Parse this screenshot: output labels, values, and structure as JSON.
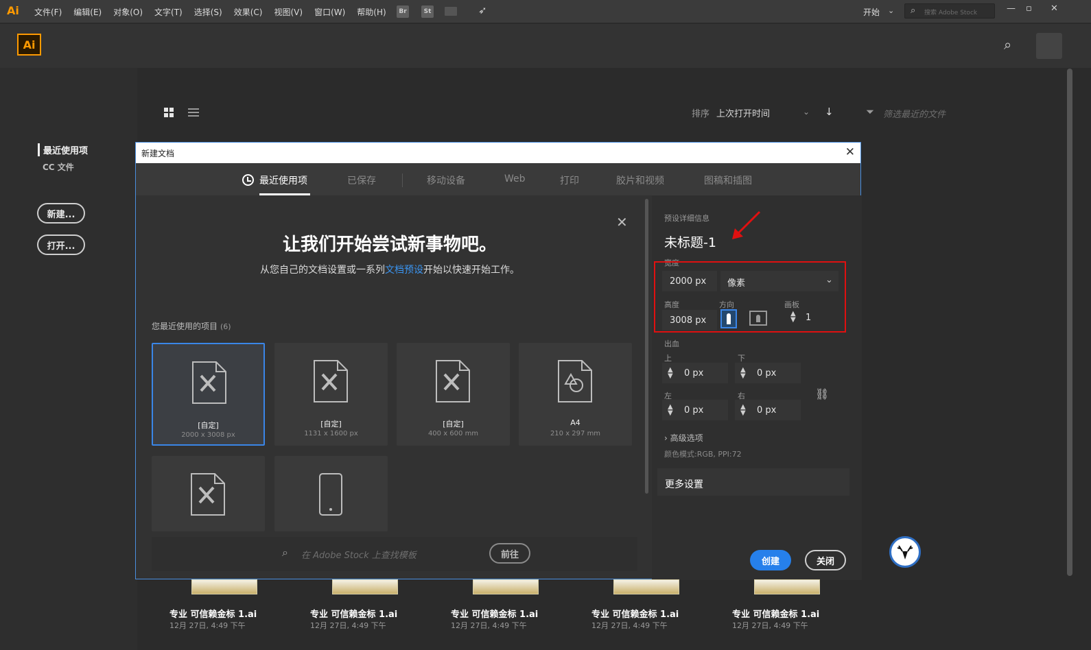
{
  "menubar": {
    "logo": "Ai",
    "items": [
      "文件(F)",
      "编辑(E)",
      "对象(O)",
      "文字(T)",
      "选择(S)",
      "效果(C)",
      "视图(V)",
      "窗口(W)",
      "帮助(H)"
    ],
    "bridge": "Br",
    "stock": "St",
    "workspace": "开始",
    "stock_search_placeholder": "搜索 Adobe Stock",
    "window_controls": [
      "—",
      "▫",
      "✕"
    ]
  },
  "header": {
    "logo": "Ai"
  },
  "left_nav": {
    "recent": "最近使用项",
    "cc_files": "CC 文件",
    "new_button": "新建...",
    "open_button": "打开..."
  },
  "toolbar": {
    "sort_label": "排序",
    "sort_value": "上次打开时间",
    "filter_placeholder": "筛选最近的文件"
  },
  "dialog": {
    "title": "新建文档",
    "tabs": [
      "最近使用项",
      "已保存",
      "移动设备",
      "Web",
      "打印",
      "胶片和视频",
      "图稿和插图"
    ],
    "welcome_title": "让我们开始尝试新事物吧。",
    "welcome_sub_before": "从您自己的文档设置或一系列",
    "welcome_sub_link": "文档预设",
    "welcome_sub_after": "开始以快速开始工作。",
    "recent_heading": "您最近使用的项目",
    "recent_count": "(6)",
    "cards": [
      {
        "name": "[自定]",
        "size": "2000 x 3008 px"
      },
      {
        "name": "[自定]",
        "size": "1131 x 1600 px"
      },
      {
        "name": "[自定]",
        "size": "400 x 600 mm"
      },
      {
        "name": "A4",
        "size": "210 x 297 mm"
      }
    ],
    "stock_placeholder": "在 Adobe Stock 上查找模板",
    "stock_go": "前往",
    "details": {
      "section_label": "预设详细信息",
      "doc_name": "未标题-1",
      "width_label": "宽度",
      "width_value": "2000 px",
      "units": "像素",
      "height_label": "高度",
      "height_value": "3008 px",
      "orientation_label": "方向",
      "artboards_label": "画板",
      "artboards_value": "1",
      "bleed_label": "出血",
      "top_label": "上",
      "top_value": "0 px",
      "bottom_label": "下",
      "bottom_value": "0 px",
      "left_label": "左",
      "left_value": "0 px",
      "right_label": "右",
      "right_value": "0 px",
      "advanced": "高级选项",
      "color_mode": "颜色模式:RGB, PPI:72",
      "more_settings": "更多设置",
      "create": "创建",
      "close": "关闭"
    }
  },
  "files": [
    {
      "name": "专业 可信赖金标 1.ai",
      "date": "12月 27日, 4:49 下午"
    },
    {
      "name": "专业 可信赖金标 1.ai",
      "date": "12月 27日, 4:49 下午"
    },
    {
      "name": "专业 可信赖金标 1.ai",
      "date": "12月 27日, 4:49 下午"
    },
    {
      "name": "专业 可信赖金标 1.ai",
      "date": "12月 27日, 4:49 下午"
    },
    {
      "name": "专业 可信赖金标 1.ai",
      "date": "12月 27日, 4:49 下午"
    }
  ],
  "colors": {
    "accent": "#2680eb",
    "brand": "#ff9a00",
    "annotation": "#e01010"
  }
}
